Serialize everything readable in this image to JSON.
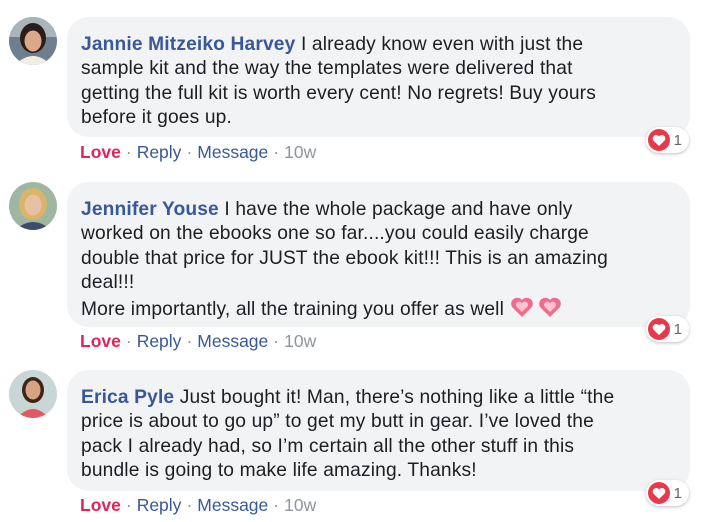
{
  "comments": [
    {
      "author": "Jannie Mitzeiko Harvey",
      "lines": [
        "I already know even with just the",
        "sample kit and the way the templates were delivered that",
        "getting the full kit is worth every cent! No regrets! Buy yours",
        "before it goes up."
      ],
      "reaction_count": "1",
      "actions": {
        "love": "Love",
        "reply": "Reply",
        "message": "Message",
        "time": "10w"
      }
    },
    {
      "author": "Jennifer Youse",
      "lines": [
        "I have the whole package and have only",
        "worked on the ebooks one so far....you could easily charge",
        "double that price for JUST the ebook kit!!! This is an amazing",
        "deal!!!",
        "More importantly, all the training you offer as well"
      ],
      "emoji": [
        "sparkling-heart-icon",
        "sparkling-heart-icon"
      ],
      "reaction_count": "1",
      "actions": {
        "love": "Love",
        "reply": "Reply",
        "message": "Message",
        "time": "10w"
      }
    },
    {
      "author": "Erica Pyle",
      "lines": [
        "Just bought it! Man, there’s nothing like a little “the",
        "price is about to go up” to get my butt in gear. I’ve loved the",
        "pack I already had, so I’m certain all the other stuff in this",
        "bundle is going to make life amazing. Thanks!"
      ],
      "reaction_count": "1",
      "actions": {
        "love": "Love",
        "reply": "Reply",
        "message": "Message",
        "time": "10w"
      }
    }
  ],
  "separator": "·",
  "colors": {
    "bubble": "#f2f3f5",
    "author": "#385898",
    "love": "#e0245e",
    "love_badge": "#e8394c"
  }
}
